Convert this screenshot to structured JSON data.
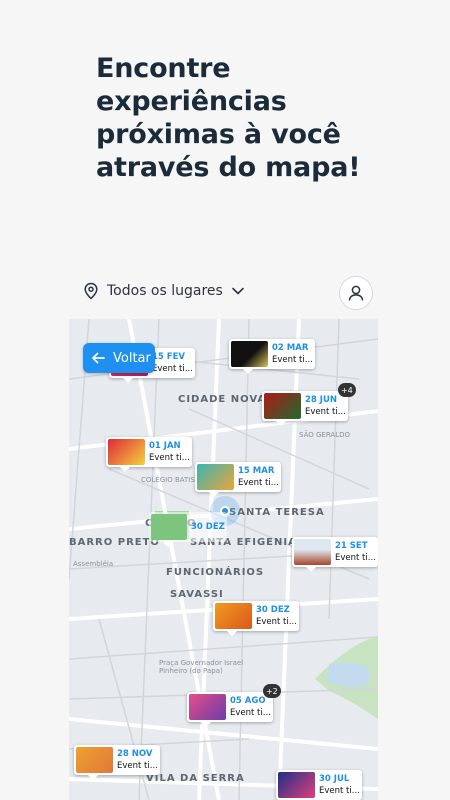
{
  "headline": "Encontre experiências próximas à você através do mapa!",
  "toolbar": {
    "location_label": "Todos os lugares",
    "location_icon": "map-pin-icon",
    "dropdown_icon": "chevron-down-icon",
    "profile_icon": "user-icon"
  },
  "map": {
    "back_label": "Voltar",
    "back_icon": "arrow-left-icon",
    "labels": {
      "cidade_nova": "CIDADE NOVA",
      "sao_geraldo": "SÃO GERALDO",
      "santa_teresa": "SANTA TERESA",
      "santa_efigenia": "SANTA EFIGENIA",
      "centro": "CENTRO",
      "barro_preto": "BARRO PRETO",
      "funcionarios": "FUNCIONÁRIOS",
      "savassi": "SAVASSI",
      "vila_da_serra": "VILA DA SERRA",
      "colegio_batista": "COLÉGIO BATISTA",
      "assembleia": "Assembléia",
      "praca": "Praça Governador Israel Pinheiro (do Papa)"
    },
    "events": [
      {
        "date": "15 FEV",
        "label": "Event ti..."
      },
      {
        "date": "02 MAR",
        "label": "Event ti..."
      },
      {
        "date": "28 JUN",
        "label": "Event ti...",
        "badge": "+4"
      },
      {
        "date": "01 JAN",
        "label": "Event ti..."
      },
      {
        "date": "15 MAR",
        "label": "Event ti..."
      },
      {
        "date": "30 DEZ",
        "label": ""
      },
      {
        "date": "21 SET",
        "label": "Event ti..."
      },
      {
        "date": "30 DEZ",
        "label": "Event ti..."
      },
      {
        "date": "05 AGO",
        "label": "Event ti...",
        "badge": "+2"
      },
      {
        "date": "28 NOV",
        "label": "Event ti..."
      },
      {
        "date": "30 JUL",
        "label": "Event ti..."
      }
    ]
  }
}
